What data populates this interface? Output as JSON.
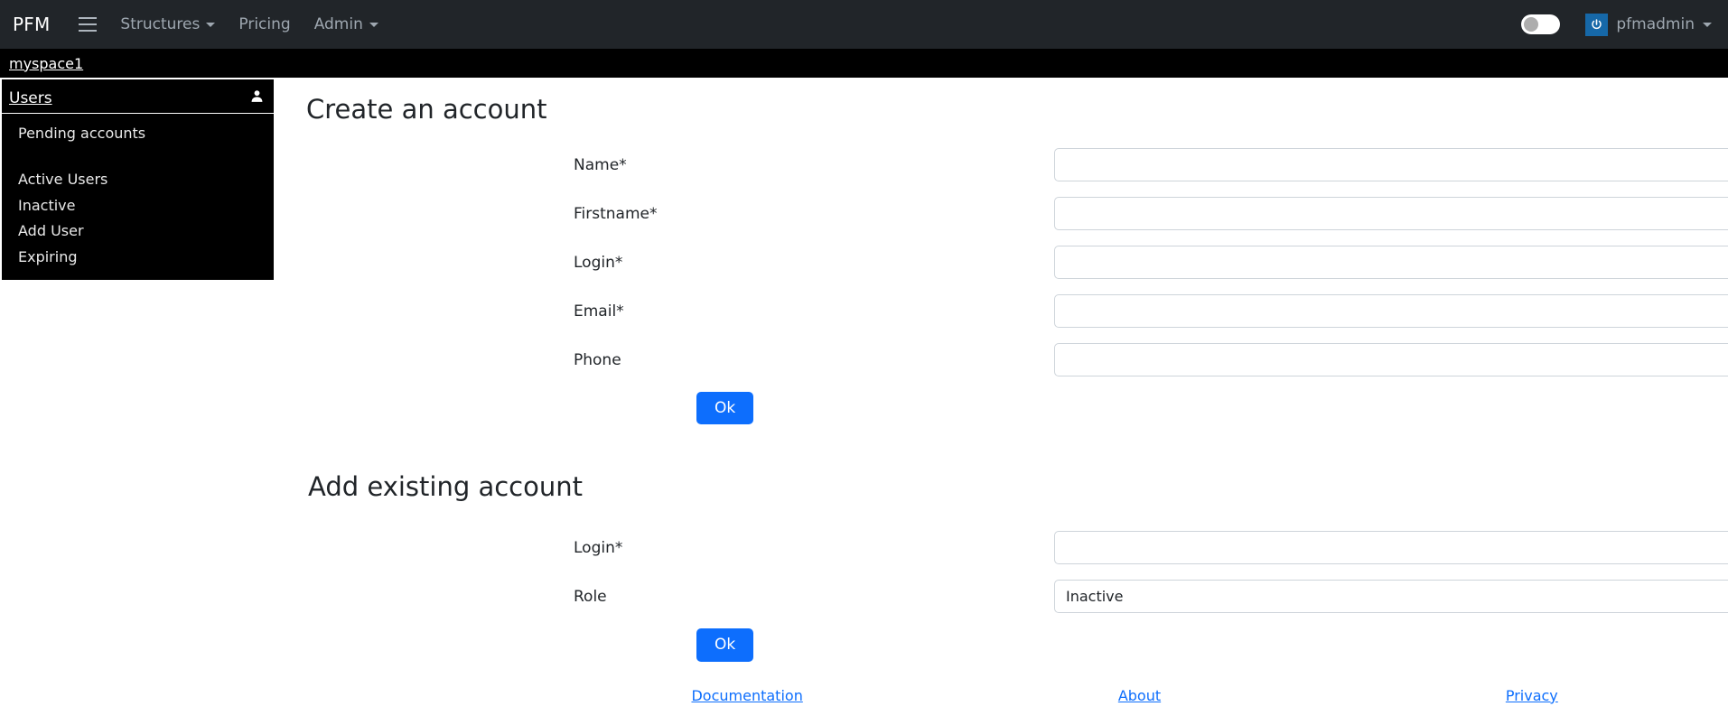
{
  "navbar": {
    "brand": "PFM",
    "menu_icon": "hamburger-icon",
    "links": [
      {
        "label": "Structures",
        "has_caret": true
      },
      {
        "label": "Pricing",
        "has_caret": false
      },
      {
        "label": "Admin",
        "has_caret": true
      }
    ],
    "theme_toggle": {
      "state": "off"
    },
    "user": {
      "label": "pfmadmin",
      "icon": "power-icon",
      "icon_color": "#1668a8"
    }
  },
  "breadcrumb": {
    "label": "myspace1"
  },
  "sidebar": {
    "title": "Users",
    "title_icon": "user-icon",
    "items": [
      {
        "label": "Pending accounts"
      },
      {
        "label": "Active Users"
      },
      {
        "label": "Inactive"
      },
      {
        "label": "Add User"
      },
      {
        "label": "Expiring"
      }
    ]
  },
  "create_account": {
    "title": "Create an account",
    "fields": [
      {
        "label": "Name*",
        "value": "",
        "placeholder": ""
      },
      {
        "label": "Firstname*",
        "value": "",
        "placeholder": ""
      },
      {
        "label": "Login*",
        "value": "",
        "placeholder": ""
      },
      {
        "label": "Email*",
        "value": "",
        "placeholder": ""
      },
      {
        "label": "Phone",
        "value": "",
        "placeholder": ""
      }
    ],
    "submit_label": "Ok"
  },
  "add_existing": {
    "title": "Add existing account",
    "login_label": "Login*",
    "login_value": "",
    "role_label": "Role",
    "role_value": "Inactive",
    "submit_label": "Ok"
  },
  "footer": {
    "links": [
      {
        "label": "Documentation"
      },
      {
        "label": "About"
      },
      {
        "label": "Privacy"
      }
    ]
  },
  "colors": {
    "navbar_bg": "#212529",
    "crumb_bg": "#000000",
    "accent": "#0d6efd",
    "border": "#ced4da"
  }
}
